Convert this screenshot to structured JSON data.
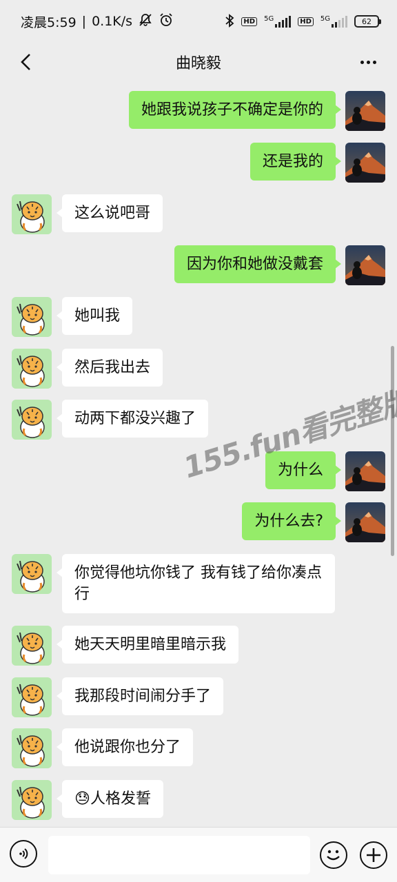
{
  "status_bar": {
    "time": "凌晨5:59",
    "network_speed": "0.1K/s",
    "icons": [
      "mute-icon",
      "alarm-icon",
      "bluetooth-icon",
      "hd-icon",
      "signal-icon",
      "hd-icon",
      "signal-icon"
    ],
    "net_type_1": "5G",
    "net_type_2": "5G",
    "hd_label": "HD",
    "battery": "62"
  },
  "header": {
    "title": "曲晓毅",
    "back_icon": "back-arrow-icon",
    "more_icon": "more-dots-icon"
  },
  "messages": [
    {
      "side": "out",
      "text": "她跟我说孩子不确定是你的"
    },
    {
      "side": "out",
      "text": "还是我的"
    },
    {
      "side": "in",
      "text": "这么说吧哥"
    },
    {
      "side": "out",
      "text": "因为你和她做没戴套"
    },
    {
      "side": "in",
      "text": "她叫我"
    },
    {
      "side": "in",
      "text": "然后我出去"
    },
    {
      "side": "in",
      "text": "动两下都没兴趣了"
    },
    {
      "side": "out",
      "text": "为什么"
    },
    {
      "side": "out",
      "text": "为什么去?"
    },
    {
      "side": "in",
      "text": "你觉得他坑你钱了 我有钱了给你凑点行"
    },
    {
      "side": "in",
      "text": "她天天明里暗里暗示我"
    },
    {
      "side": "in",
      "text": "我那段时间闹分手了"
    },
    {
      "side": "in",
      "text": "他说跟你也分了"
    },
    {
      "side": "in",
      "text": "人格发誓",
      "emoji": "😓"
    }
  ],
  "watermark": "155.fun看完整版",
  "input_bar": {
    "voice_icon": "voice-icon",
    "input_value": "",
    "emoji_icon": "emoji-icon",
    "plus_icon": "plus-icon"
  },
  "colors": {
    "background": "#ededed",
    "outgoing_bubble": "#95ec69",
    "incoming_bubble": "#ffffff"
  }
}
